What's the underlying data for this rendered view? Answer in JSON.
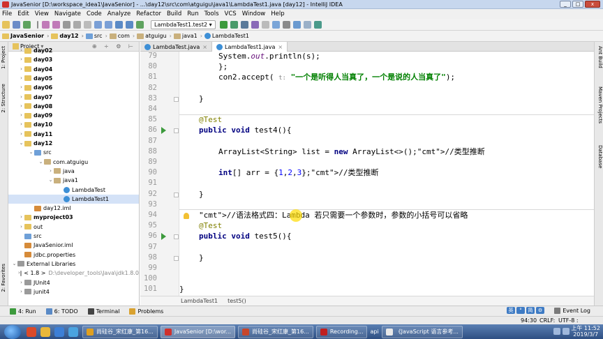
{
  "window": {
    "title": "JavaSenior [D:\\workspace_idea1\\JavaSenior] - ...\\day12\\src\\com\\atguigu\\java1\\LambdaTest1.java [day12] - IntelliJ IDEA",
    "buttons": [
      "_",
      "□",
      "x"
    ]
  },
  "menu": [
    "File",
    "Edit",
    "View",
    "Navigate",
    "Code",
    "Analyze",
    "Refactor",
    "Build",
    "Run",
    "Tools",
    "VCS",
    "Window",
    "Help"
  ],
  "toolbar": {
    "run_config": "LambdaTest1.test2 ▾"
  },
  "navbar": {
    "crumbs": [
      "JavaSenior",
      "day12",
      "src",
      "com",
      "atguigu",
      "java1",
      "LambdaTest1"
    ]
  },
  "left_strip": {
    "project": "1: Project",
    "structure": "2: Structure",
    "favorites": "2: Favorites"
  },
  "right_strip": {
    "ant": "Ant Build",
    "maven": "Maven Projects",
    "database": "Database"
  },
  "project_panel": {
    "header": "Project",
    "tree": [
      {
        "label": "day02",
        "kind": "folder",
        "bold": true
      },
      {
        "label": "day03",
        "kind": "folder",
        "bold": true
      },
      {
        "label": "day04",
        "kind": "folder",
        "bold": true
      },
      {
        "label": "day05",
        "kind": "folder",
        "bold": true
      },
      {
        "label": "day06",
        "kind": "folder",
        "bold": true
      },
      {
        "label": "day07",
        "kind": "folder",
        "bold": true
      },
      {
        "label": "day08",
        "kind": "folder",
        "bold": true
      },
      {
        "label": "day09",
        "kind": "folder",
        "bold": true
      },
      {
        "label": "day10",
        "kind": "folder",
        "bold": true
      },
      {
        "label": "day11",
        "kind": "folder",
        "bold": true
      },
      {
        "label": "day12",
        "kind": "folder",
        "bold": true
      },
      {
        "label": "src",
        "kind": "src"
      },
      {
        "label": "com.atguigu",
        "kind": "pkg"
      },
      {
        "label": "java",
        "kind": "pkg"
      },
      {
        "label": "java1",
        "kind": "pkg"
      },
      {
        "label": "LambdaTest",
        "kind": "cls"
      },
      {
        "label": "LambdaTest1",
        "kind": "cls"
      },
      {
        "label": "day12.iml",
        "kind": "xml"
      },
      {
        "label": "myproject03",
        "kind": "folder",
        "bold": true
      },
      {
        "label": "out",
        "kind": "folder"
      },
      {
        "label": "src",
        "kind": "src"
      },
      {
        "label": "JavaSenior.iml",
        "kind": "xml"
      },
      {
        "label": "jdbc.properties",
        "kind": "xml"
      },
      {
        "label": "External Libraries",
        "kind": "lib"
      },
      {
        "label": "< 1.8 >",
        "kind": "lib",
        "extra": "D:\\developer_tools\\Java\\jdk1.8.0"
      },
      {
        "label": "JUnit4",
        "kind": "lib"
      },
      {
        "label": "junit4",
        "kind": "lib"
      }
    ]
  },
  "editor": {
    "tabs": [
      {
        "label": "LambdaTest.java",
        "close": "×"
      },
      {
        "label": "LambdaTest1.java",
        "close": "×"
      }
    ],
    "lines": [
      {
        "n": "79",
        "code": "System.out.println(s);"
      },
      {
        "n": "80",
        "code": "};"
      },
      {
        "n": "81",
        "code": "con2.accept( t: \"一个是听得人当真了，一个是说的人当真了\");"
      },
      {
        "n": "82",
        "code": ""
      },
      {
        "n": "83",
        "code": "}"
      },
      {
        "n": "84",
        "code": ""
      },
      {
        "n": "85",
        "code": "@Test"
      },
      {
        "n": "86",
        "code": "public void test4(){"
      },
      {
        "n": "87",
        "code": ""
      },
      {
        "n": "88",
        "code": "ArrayList<String> list = new ArrayList<>();//类型推断"
      },
      {
        "n": "89",
        "code": ""
      },
      {
        "n": "90",
        "code": "int[] arr = {1,2,3};//类型推断"
      },
      {
        "n": "91",
        "code": ""
      },
      {
        "n": "92",
        "code": "}"
      },
      {
        "n": "93",
        "code": ""
      },
      {
        "n": "94",
        "code": "//语法格式四：Lambda 若只需要一个参数时，参数的小括号可以省略"
      },
      {
        "n": "95",
        "code": "@Test"
      },
      {
        "n": "96",
        "code": "public void test5(){"
      },
      {
        "n": "97",
        "code": ""
      },
      {
        "n": "98",
        "code": "}"
      },
      {
        "n": "99",
        "code": ""
      },
      {
        "n": "100",
        "code": ""
      },
      {
        "n": "101",
        "code": "}"
      }
    ],
    "breadcrumb": [
      "LambdaTest1",
      "test5()"
    ]
  },
  "bottom_tabs": [
    {
      "label": "4: Run",
      "color": "#3c9a3c"
    },
    {
      "label": "6: TODO",
      "color": "#5a8ac6"
    },
    {
      "label": "Terminal",
      "color": "#444444"
    },
    {
      "label": "Problems",
      "color": "#d9a230"
    }
  ],
  "event_log": "Event Log",
  "status": {
    "position": "94:30",
    "line_sep": "CRLF:",
    "encoding": "UTF-8 :"
  },
  "ime": [
    "英",
    "°",
    "简",
    "⚙"
  ],
  "taskbar": {
    "items": [
      {
        "label": "尚硅谷_宋红康_第16...",
        "color": "#e0a020"
      },
      {
        "label": "JavaSenior [D:\\wor...",
        "color": "#d0312d",
        "active": true
      },
      {
        "label": "尚硅谷_宋红康_第16...",
        "color": "#c7462c"
      },
      {
        "label": "Recording...",
        "color": "#c02020"
      },
      {
        "label": "《JavaScript 语言参考...",
        "color": "#e8e8e8"
      }
    ],
    "extra": "api",
    "time": "上午 11:52",
    "date": "2019/3/7"
  }
}
